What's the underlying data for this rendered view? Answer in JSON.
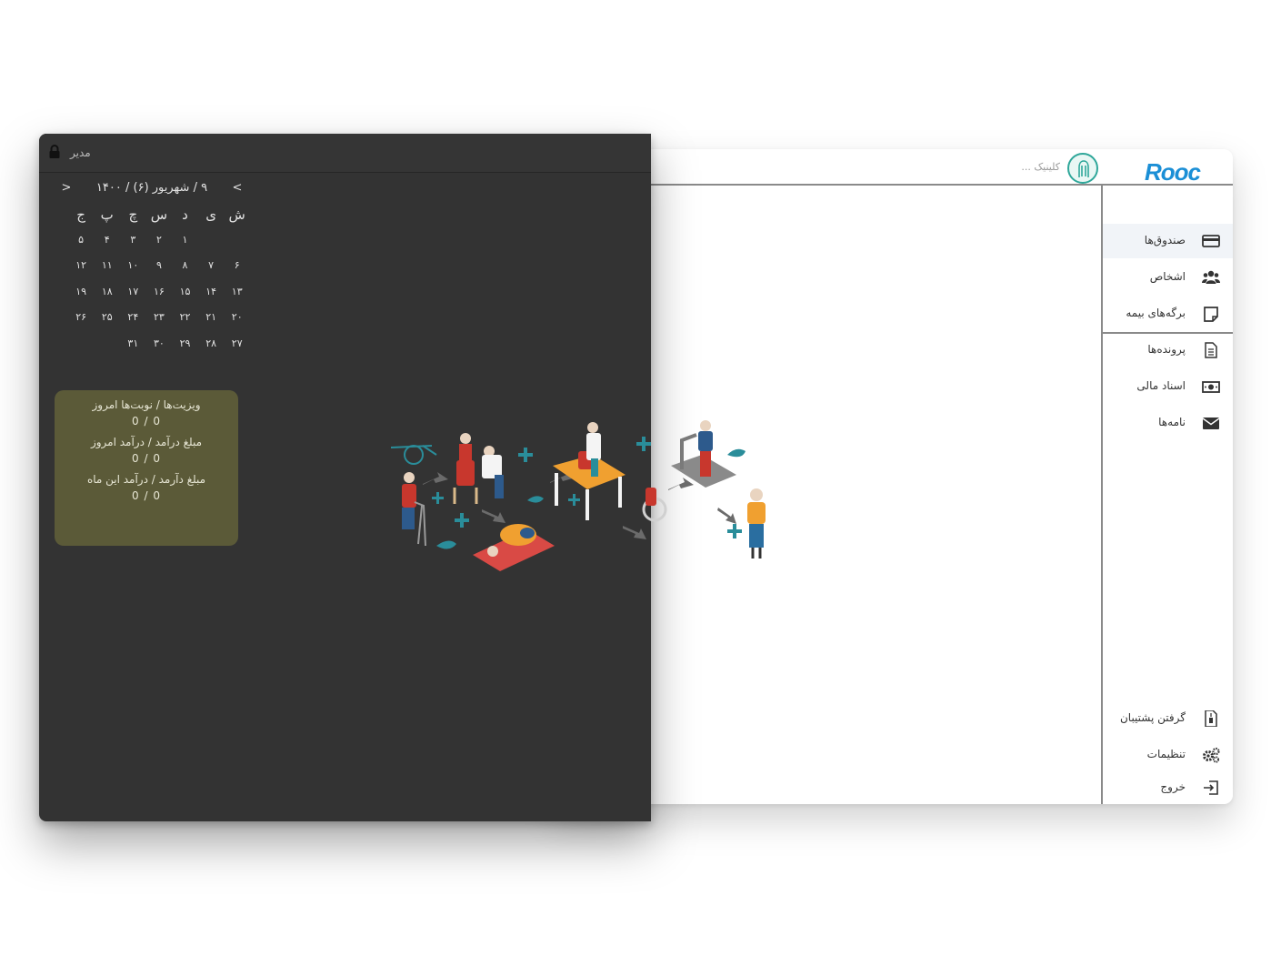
{
  "light_app": {
    "logo": "Rooc",
    "clinic_placeholder": "کلینیک ...",
    "nav": [
      {
        "label": "صندوق‌ها",
        "icon": "credit-card-icon",
        "active": true
      },
      {
        "label": "اشخاص",
        "icon": "users-icon"
      },
      {
        "label": "برگه‌های بیمه",
        "icon": "sticky-note-icon"
      },
      {
        "label": "پرونده‌ها",
        "icon": "document-icon"
      },
      {
        "label": "اسناد مالی",
        "icon": "money-bill-icon"
      },
      {
        "label": "نامه‌ها",
        "icon": "envelope-icon"
      }
    ],
    "bottom_nav": [
      {
        "label": "گرفتن پشتیبان",
        "icon": "backup-file-icon"
      },
      {
        "label": "تنظیمات",
        "icon": "cogs-icon"
      },
      {
        "label": "خروج",
        "icon": "sign-out-icon"
      }
    ]
  },
  "dark_app": {
    "user": "مدیر",
    "calendar": {
      "title": "۹ / شهریور (۶) / ۱۴۰۰",
      "prev": "<",
      "next": ">",
      "weekdays": [
        "ش",
        "ی",
        "د",
        "س",
        "چ",
        "پ",
        "ج"
      ],
      "weeks": [
        [
          "",
          "",
          "",
          "۱",
          "۲",
          "۳",
          "۴",
          "۵"
        ],
        [
          "۶",
          "۷",
          "۸",
          "۹",
          "۱۰",
          "۱۱",
          "۱۲"
        ],
        [
          "۱۳",
          "۱۴",
          "۱۵",
          "۱۶",
          "۱۷",
          "۱۸",
          "۱۹"
        ],
        [
          "۲۰",
          "۲۱",
          "۲۲",
          "۲۳",
          "۲۴",
          "۲۵",
          "۲۶"
        ],
        [
          "۲۷",
          "۲۸",
          "۲۹",
          "۳۰",
          "۳۱",
          "",
          ""
        ]
      ]
    },
    "stats": [
      {
        "label": "ویزیت‌ها / نوبت‌ها امروز",
        "value": "0 / 0"
      },
      {
        "label": "مبلغ درآمد / درآمد امروز",
        "value": "0 / 0"
      },
      {
        "label": "مبلغ دآرمد / درآمد این ماه",
        "value": "0 / 0"
      }
    ]
  },
  "colors": {
    "dark_bg": "#333333",
    "stats_bg": "#5b5a38",
    "logo": "#1b8fd6",
    "accent_teal": "#2a8d9a",
    "accent_orange": "#f0a030"
  }
}
